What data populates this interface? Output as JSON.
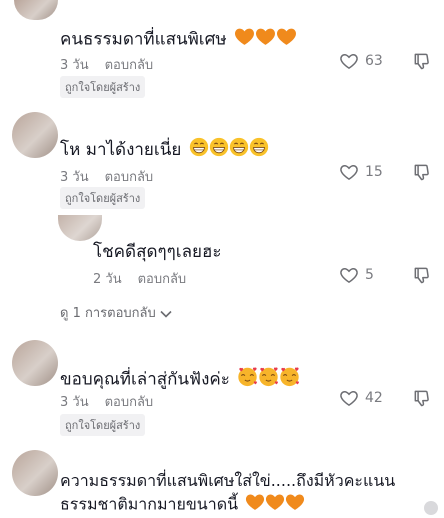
{
  "comments": [
    {
      "text": "คนธรรมดาที่แสนพิเศษ",
      "time": "3 วัน",
      "reply": "ตอบกลับ",
      "likes": "63",
      "creator_badge": "ถูกใจโดยผู้สร้าง"
    },
    {
      "text": "โห มาได้งายเนี่ย",
      "time": "3 วัน",
      "reply": "ตอบกลับ",
      "likes": "15",
      "creator_badge": "ถูกใจโดยผู้สร้าง"
    },
    {
      "text": "โชคดีสุดๆๆเลยฮะ",
      "time": "2 วัน",
      "reply": "ตอบกลับ",
      "likes": "5"
    },
    {
      "text": "ขอบคุณที่เล่าสู่กันฟังค่ะ",
      "time": "3 วัน",
      "reply": "ตอบกลับ",
      "likes": "42",
      "creator_badge": "ถูกใจโดยผู้สร้าง"
    },
    {
      "text_line1": "ความธรรมดาที่แสนพิเศษใส่ใข่.....ถึงมีหัวคะแนน",
      "text_line2": "ธรรมชาติมากมายขนาดนี้"
    }
  ],
  "view_replies": "ดู 1 การตอบกลับ",
  "icons": {
    "like": "heart-outline-icon",
    "dislike": "thumbs-down-icon",
    "expand": "chevron-down-icon"
  },
  "colors": {
    "heart_emoji": "#f08a1c",
    "text": "#161823",
    "meta": "#7a7b80"
  }
}
